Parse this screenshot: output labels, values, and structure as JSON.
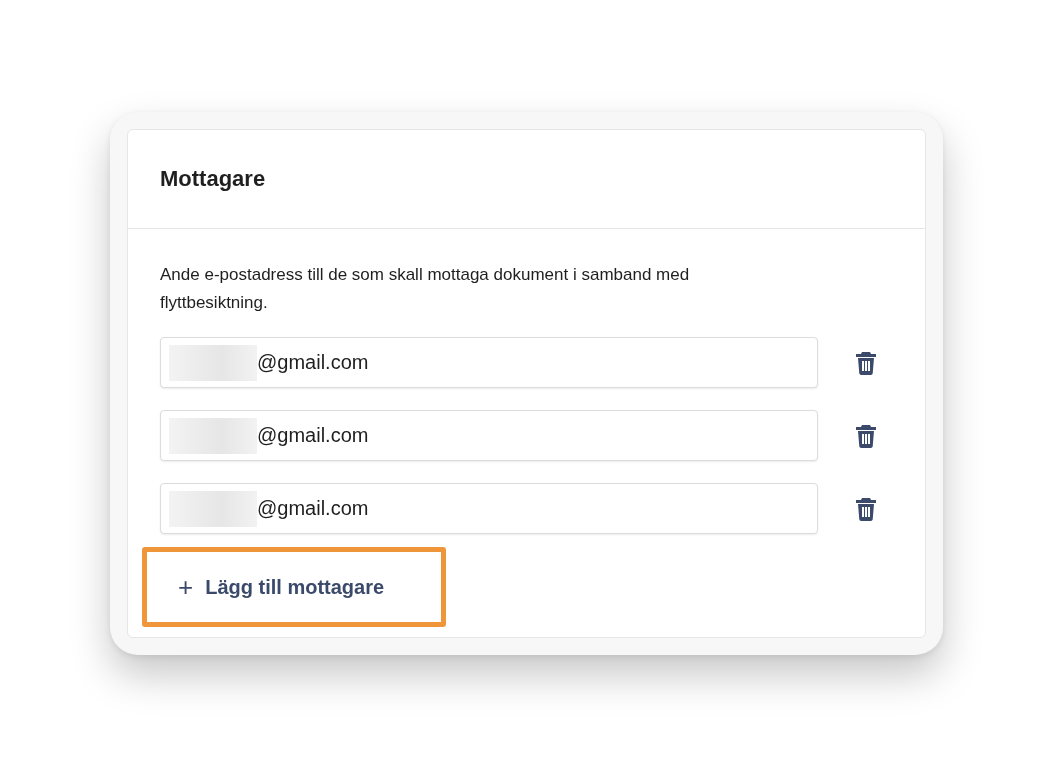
{
  "card": {
    "title": "Mottagare",
    "description": "Ande e-postadress till de som skall mottaga dokument i samband med flyttbesiktning.",
    "recipients": [
      {
        "value": "@gmail.com",
        "redacted": true
      },
      {
        "value": "@gmail.com",
        "redacted": true
      },
      {
        "value": "@gmail.com",
        "redacted": true
      }
    ],
    "add_button": {
      "icon": "+",
      "label": "Lägg till mottagare",
      "highlighted": true
    }
  }
}
